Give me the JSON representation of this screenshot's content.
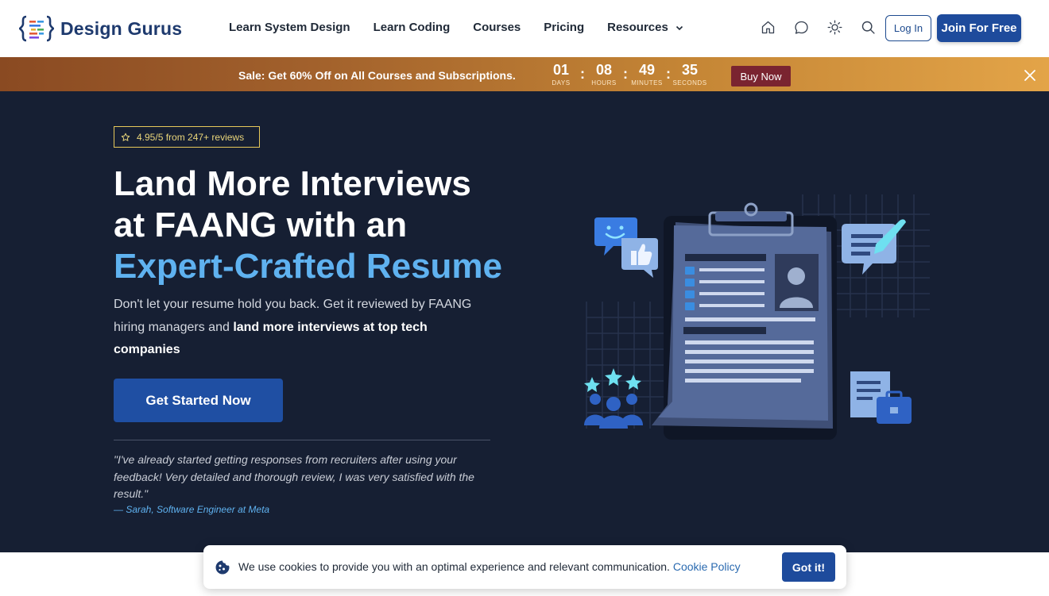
{
  "header": {
    "brand": "Design Gurus",
    "nav": [
      {
        "label": "Learn System Design"
      },
      {
        "label": "Learn Coding"
      },
      {
        "label": "Courses"
      },
      {
        "label": "Pricing"
      },
      {
        "label": "Resources"
      }
    ],
    "icons": [
      "home-icon",
      "chat-icon",
      "sun-icon",
      "search-icon"
    ],
    "login_label": "Log In",
    "join_label": "Join For Free"
  },
  "sale": {
    "text": "Sale: Get 60% Off on All Courses and Subscriptions.",
    "countdown": [
      {
        "value": "01",
        "label": "DAYS"
      },
      {
        "value": "08",
        "label": "HOURS"
      },
      {
        "value": "49",
        "label": "MINUTES"
      },
      {
        "value": "35",
        "label": "SECONDS"
      }
    ],
    "separator": ":",
    "buy_label": "Buy Now"
  },
  "hero": {
    "rating": "4.95/5 from 247+ reviews",
    "title_line1": "Land More Interviews",
    "title_line2": "at FAANG with an",
    "title_accent": "Expert-Crafted Resume",
    "lead_plain": "Don't let your resume hold you back. Get it reviewed by FAANG hiring managers and ",
    "lead_bold": "land more interviews at top tech companies",
    "cta_label": "Get Started Now",
    "quote": "\"I've already started getting responses from recruiters after using your feedback! Very detailed and thorough review, I was very satisfied with the result.\"",
    "quote_author": "— Sarah, Software Engineer at Meta"
  },
  "cookie": {
    "text": "We use cookies to provide you with an optimal experience and relevant communication.",
    "link": "Cookie Policy",
    "button": "Got it!"
  },
  "colors": {
    "brand_blue": "#1e4b9c",
    "hero_bg": "#161f33",
    "accent": "#5fb2f0",
    "star_yellow": "#e7c95a"
  }
}
